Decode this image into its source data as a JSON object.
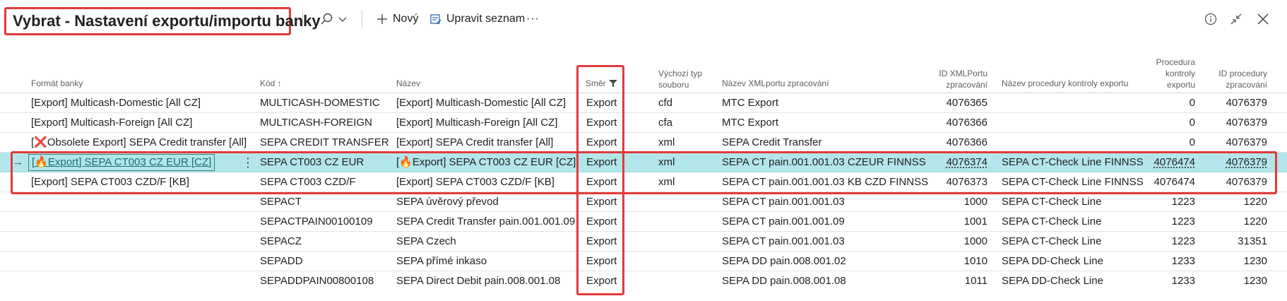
{
  "header": {
    "title": "Vybrat - Nastavení exportu/importu banky",
    "new_label": "Nový",
    "edit_list_label": "Upravit seznam",
    "more_label": "···"
  },
  "columns": {
    "bank_format": "Formát banky",
    "code": "Kód ↑",
    "name": "Název",
    "direction": "Směr",
    "file_type_1": "Výchozí typ",
    "file_type_2": "souboru",
    "xmlport_name": "Název XMLportu zpracování",
    "xmlport_id_1": "ID XMLPortu",
    "xmlport_id_2": "zpracování",
    "check_proc_name": "Název procedury kontroly exportu",
    "check_proc_1": "Procedura",
    "check_proc_2": "kontroly",
    "check_proc_3": "exportu",
    "proc_id_1": "ID procedury",
    "proc_id_2": "zpracování"
  },
  "rows": [
    {
      "format": "[Export] Multicash-Domestic [All CZ]",
      "code": "MULTICASH-DOMESTIC",
      "name": "[Export] Multicash-Domestic [All CZ]",
      "direction": "Export",
      "file_type": "cfd",
      "xmlport_name": "MTC Export",
      "xmlport_id": "4076365",
      "check_name": "",
      "check_id": "0",
      "proc_id": "4076379"
    },
    {
      "format": "[Export] Multicash-Foreign [All CZ]",
      "code": "MULTICASH-FOREIGN",
      "name": "[Export] Multicash-Foreign [All CZ]",
      "direction": "Export",
      "file_type": "cfa",
      "xmlport_name": "MTC Export",
      "xmlport_id": "4076366",
      "check_name": "",
      "check_id": "0",
      "proc_id": "4076379"
    },
    {
      "format": "[❌Obsolete Export] SEPA Credit transfer [All]",
      "code": "SEPA CREDIT TRANSFER",
      "name": "[Export] SEPA Credit transfer [All]",
      "direction": "Export",
      "file_type": "xml",
      "xmlport_name": "SEPA Credit Transfer",
      "xmlport_id": "4076366",
      "check_name": "",
      "check_id": "0",
      "proc_id": "4076379"
    },
    {
      "format": "[🔥Export] SEPA CT003 CZ EUR [CZ]",
      "code": "SEPA CT003 CZ EUR",
      "name": "[🔥Export] SEPA CT003 CZ EUR [CZ]",
      "direction": "Export",
      "file_type": "xml",
      "xmlport_name": "SEPA CT pain.001.001.03 CZEUR FINNSS",
      "xmlport_id": "4076374",
      "check_name": "SEPA CT-Check Line FINNSS",
      "check_id": "4076474",
      "proc_id": "4076379"
    },
    {
      "format": "[Export] SEPA CT003 CZD/F [KB]",
      "code": "SEPA CT003 CZD/F",
      "name": "[Export] SEPA CT003 CZD/F [KB]",
      "direction": "Export",
      "file_type": "xml",
      "xmlport_name": "SEPA CT pain.001.001.03 KB CZD FINNSS",
      "xmlport_id": "4076373",
      "check_name": "SEPA CT-Check Line FINNSS",
      "check_id": "4076474",
      "proc_id": "4076379"
    },
    {
      "format": "",
      "code": "SEPACT",
      "name": "SEPA úvěrový převod",
      "direction": "Export",
      "file_type": "",
      "xmlport_name": "SEPA CT pain.001.001.03",
      "xmlport_id": "1000",
      "check_name": "SEPA CT-Check Line",
      "check_id": "1223",
      "proc_id": "1220"
    },
    {
      "format": "",
      "code": "SEPACTPAIN00100109",
      "name": "SEPA Credit Transfer pain.001.001.09",
      "direction": "Export",
      "file_type": "",
      "xmlport_name": "SEPA CT pain.001.001.09",
      "xmlport_id": "1001",
      "check_name": "SEPA CT-Check Line",
      "check_id": "1223",
      "proc_id": "1220"
    },
    {
      "format": "",
      "code": "SEPACZ",
      "name": "SEPA Czech",
      "direction": "Export",
      "file_type": "",
      "xmlport_name": "SEPA CT pain.001.001.03",
      "xmlport_id": "1000",
      "check_name": "SEPA CT-Check Line",
      "check_id": "1223",
      "proc_id": "31351"
    },
    {
      "format": "",
      "code": "SEPADD",
      "name": "SEPA přímé inkaso",
      "direction": "Export",
      "file_type": "",
      "xmlport_name": "SEPA DD pain.008.001.02",
      "xmlport_id": "1010",
      "check_name": "SEPA DD-Check Line",
      "check_id": "1233",
      "proc_id": "1230"
    },
    {
      "format": "",
      "code": "SEPADDPAIN00800108",
      "name": "SEPA Direct Debit pain.008.001.08",
      "direction": "Export",
      "file_type": "",
      "xmlport_name": "SEPA DD pain.008.001.08",
      "xmlport_id": "1011",
      "check_name": "SEPA DD-Check Line",
      "check_id": "1233",
      "proc_id": "1230"
    }
  ],
  "selected_row": 3,
  "colors": {
    "highlight": "#e03b3b",
    "selected_row": "#b3e6ea",
    "link": "#1a6c74"
  }
}
